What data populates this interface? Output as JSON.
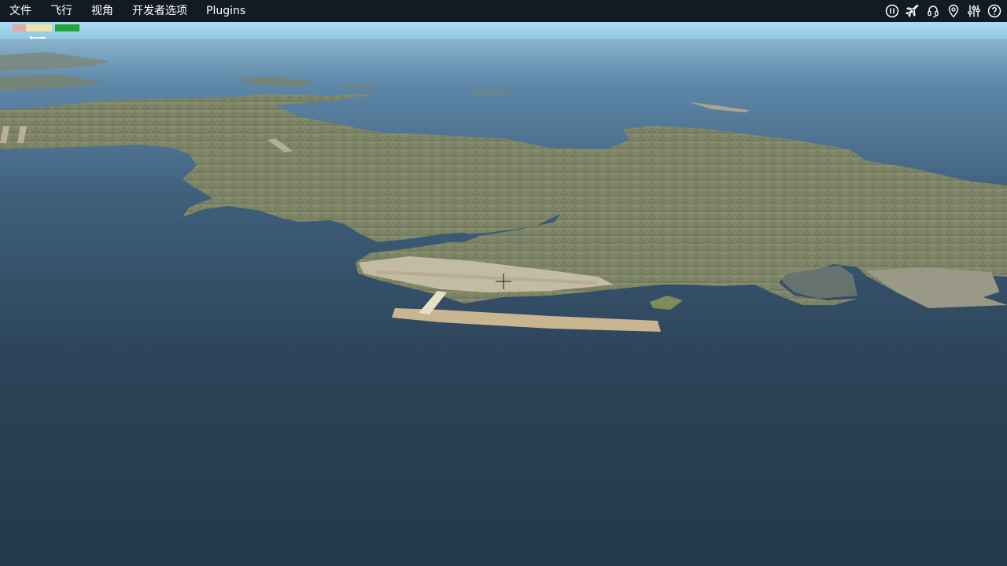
{
  "menu": {
    "items": [
      {
        "label": "文件"
      },
      {
        "label": "飞行"
      },
      {
        "label": "视角"
      },
      {
        "label": "开发者选项"
      },
      {
        "label": "Plugins"
      }
    ]
  },
  "toolbar": {
    "icons": [
      "pause-icon",
      "airplane-icon",
      "headset-icon",
      "map-pin-icon",
      "sliders-icon",
      "help-icon"
    ]
  },
  "perf_bar": {
    "segments": [
      {
        "color": "#e6a7a7"
      },
      {
        "color": "#ece3a4"
      },
      {
        "color": "#1fa53a"
      }
    ]
  },
  "colors": {
    "menubar": "#121a24",
    "sky": "#9fd3ef",
    "sea_far": "#5c86a8",
    "sea_near": "#223445",
    "land": "#7c8465",
    "land_dark": "#66704f",
    "runway": "#c9b58f"
  }
}
